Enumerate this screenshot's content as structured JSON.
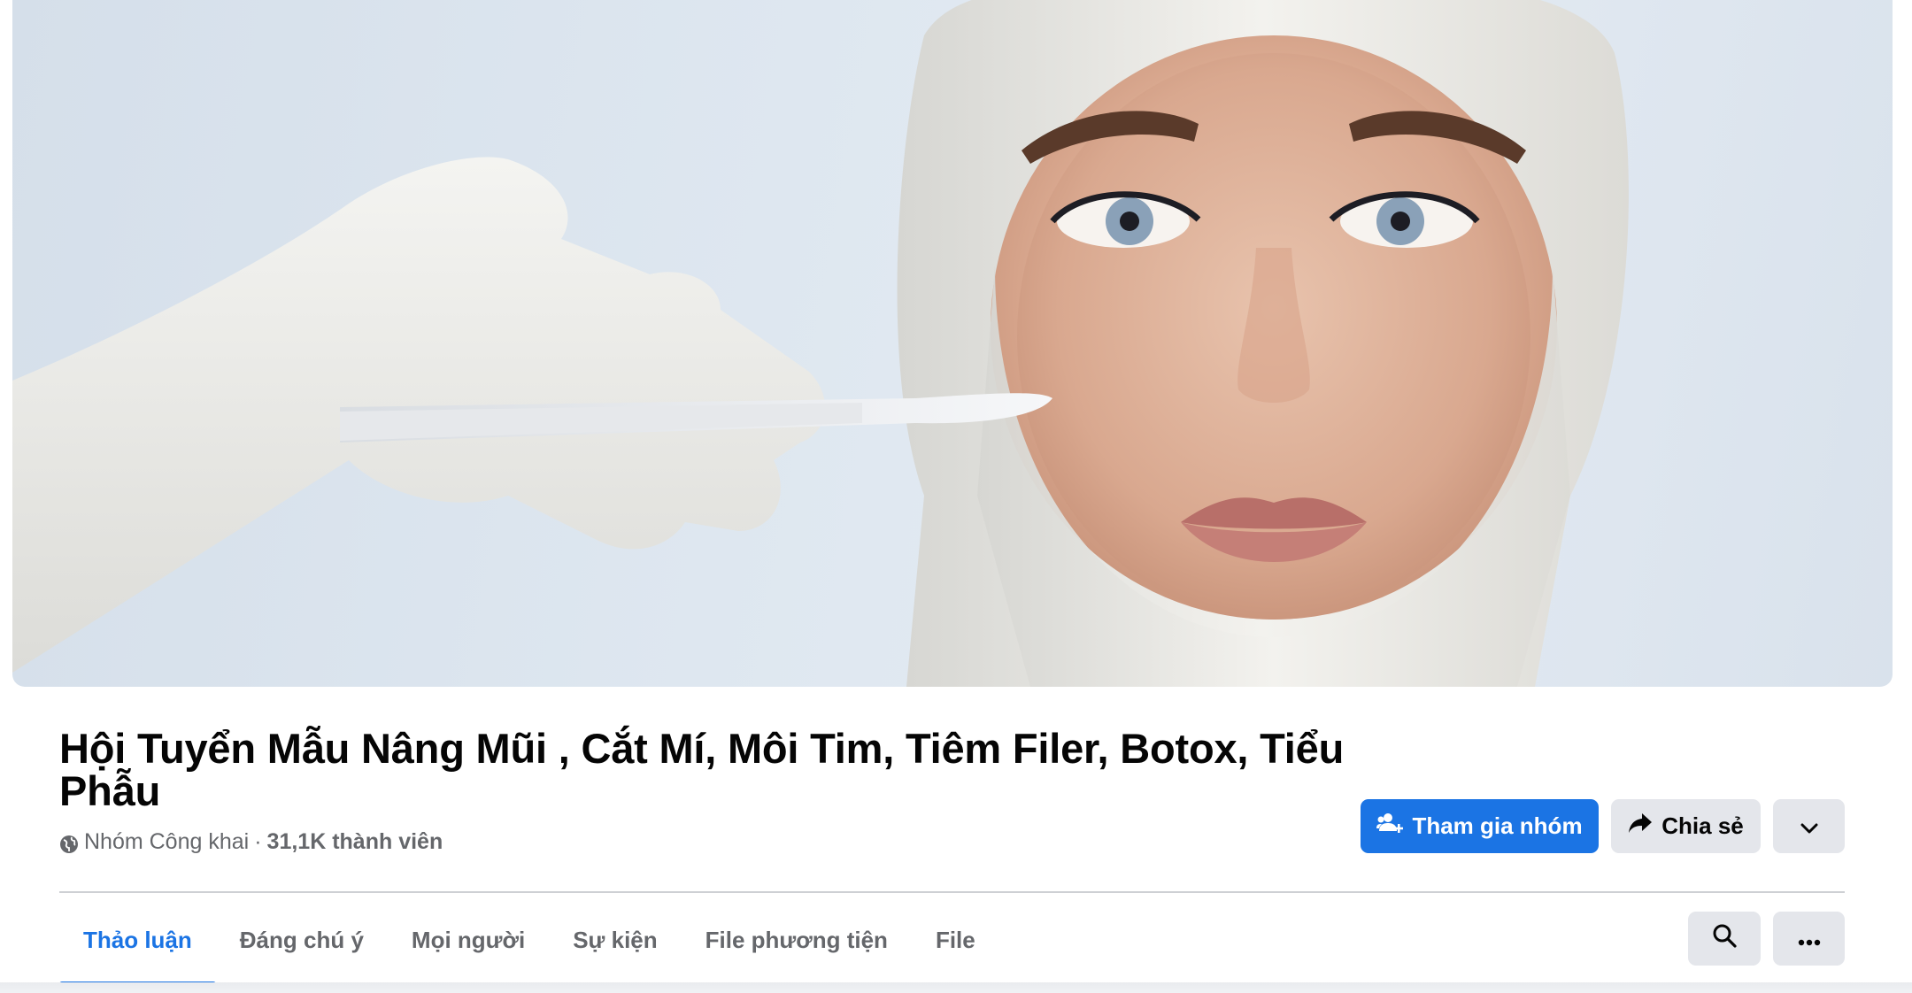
{
  "group": {
    "title": "Hội Tuyển Mẫu Nâng Mũi , Cắt Mí, Môi Tim, Tiêm Filer, Botox, Tiểu Phẫu",
    "privacy": "Nhóm Công khai",
    "separator": "·",
    "members": "31,1K thành viên"
  },
  "actions": {
    "join_label": "Tham gia nhóm",
    "share_label": "Chia sẻ",
    "join_icon": "people-plus-icon",
    "share_icon": "share-arrow-icon",
    "more_icon": "chevron-down-icon"
  },
  "tabs": [
    {
      "label": "Thảo luận",
      "active": true
    },
    {
      "label": "Đáng chú ý",
      "active": false
    },
    {
      "label": "Mọi người",
      "active": false
    },
    {
      "label": "Sự kiện",
      "active": false
    },
    {
      "label": "File phương tiện",
      "active": false
    },
    {
      "label": "File",
      "active": false
    }
  ],
  "toolbar": {
    "search_icon": "search-icon",
    "options_icon": "more-dots-icon"
  },
  "colors": {
    "accent": "#1b74e4",
    "button_gray": "#e4e6eb",
    "text_secondary": "#65676b"
  }
}
